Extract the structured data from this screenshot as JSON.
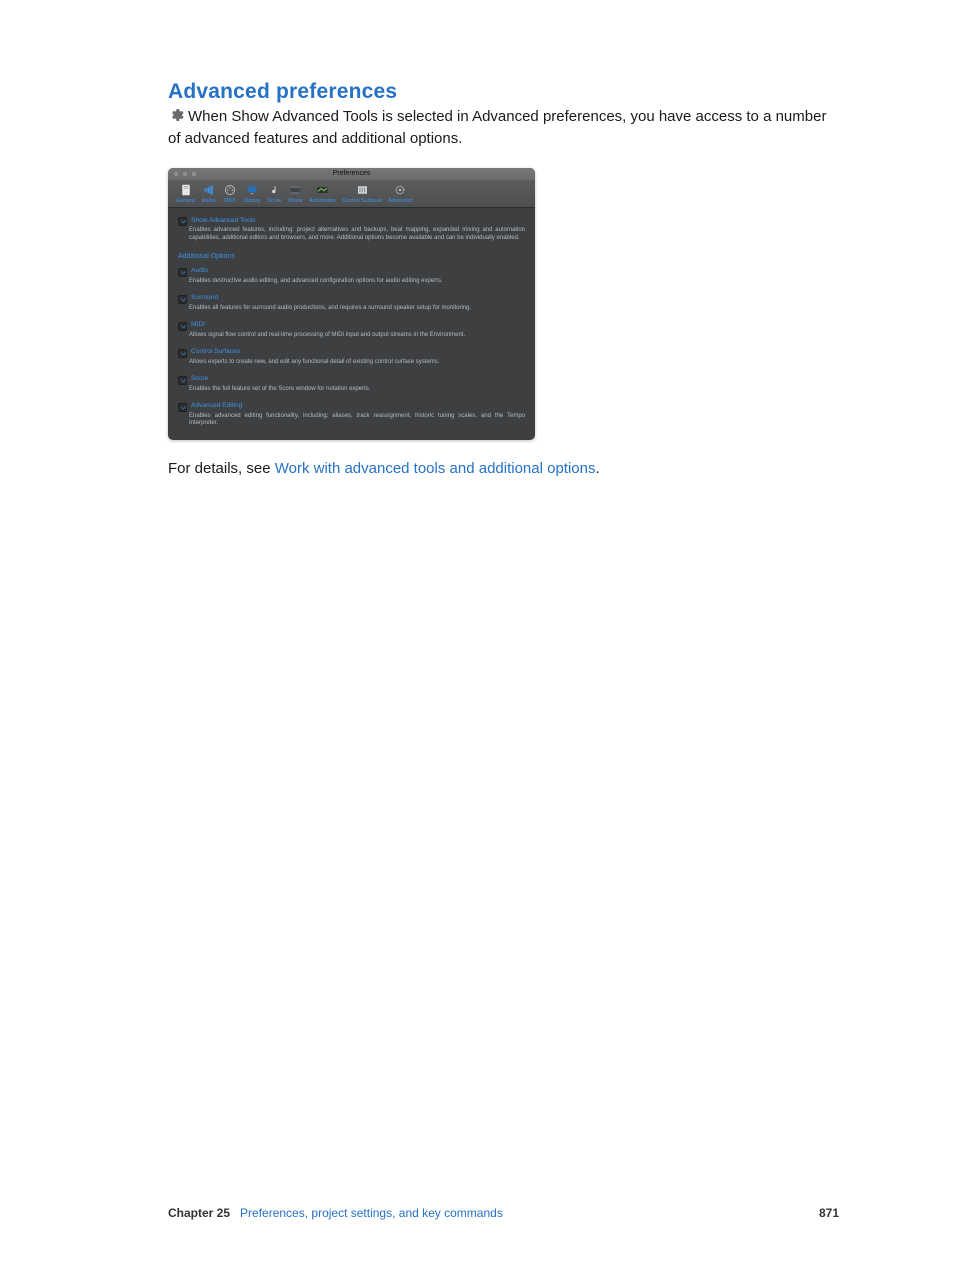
{
  "heading": "Advanced preferences",
  "intro": "When Show Advanced Tools is selected in Advanced preferences, you have access to a number of advanced features and additional options.",
  "prefs": {
    "window_title": "Preferences",
    "tabs": [
      "General",
      "Audio",
      "MIDI",
      "Display",
      "Score",
      "Movie",
      "Automation",
      "Control Surfaces",
      "Advanced"
    ],
    "show_advanced": {
      "label": "Show Advanced Tools",
      "desc": "Enables advanced features, including: project alternatives and backups, beat mapping, expanded mixing and automation capabilities, additional editors and browsers, and more. Additional options become available and can be individually enabled."
    },
    "additional_header": "Additional Options",
    "options": [
      {
        "label": "Audio",
        "desc": "Enables destructive audio editing, and advanced configuration options for audio editing experts."
      },
      {
        "label": "Surround",
        "desc": "Enables all features for surround audio productions, and requires a surround speaker setup for monitoring."
      },
      {
        "label": "MIDI",
        "desc": "Allows signal flow control and real-time processing of MIDI input and output streams in the Environment."
      },
      {
        "label": "Control Surfaces",
        "desc": "Allows experts to create new, and edit any functional detail of existing control surface systems."
      },
      {
        "label": "Score",
        "desc": "Enables the full feature set of the Score window for notation experts."
      },
      {
        "label": "Advanced Editing",
        "desc": "Enables advanced editing functionality, including: aliases, track reassignment, historic tuning scales, and the Tempo Interpreter."
      }
    ]
  },
  "details": {
    "prefix": "For details, see ",
    "link": "Work with advanced tools and additional options",
    "suffix": "."
  },
  "footer": {
    "chapter": "Chapter  25",
    "title": "Preferences, project settings, and key commands",
    "page": "871"
  }
}
